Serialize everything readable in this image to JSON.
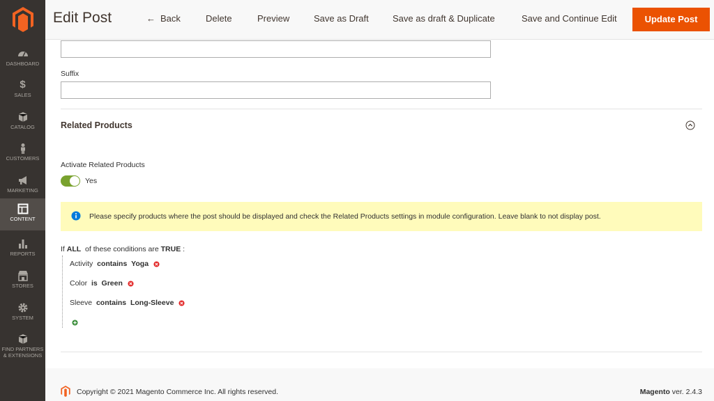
{
  "sidebar": {
    "items": [
      {
        "label": "DASHBOARD",
        "icon": "dashboard-icon"
      },
      {
        "label": "SALES",
        "icon": "dollar-icon"
      },
      {
        "label": "CATALOG",
        "icon": "cube-icon"
      },
      {
        "label": "CUSTOMERS",
        "icon": "person-icon"
      },
      {
        "label": "MARKETING",
        "icon": "megaphone-icon"
      },
      {
        "label": "CONTENT",
        "icon": "layout-icon"
      },
      {
        "label": "REPORTS",
        "icon": "bar-chart-icon"
      },
      {
        "label": "STORES",
        "icon": "storefront-icon"
      },
      {
        "label": "SYSTEM",
        "icon": "gear-icon"
      },
      {
        "label": "FIND PARTNERS",
        "label2": "& EXTENSIONS",
        "icon": "box-icon"
      }
    ]
  },
  "header": {
    "title": "Edit Post",
    "back": "Back",
    "delete": "Delete",
    "preview": "Preview",
    "save_draft": "Save as Draft",
    "save_duplicate": "Save as draft & Duplicate",
    "save_continue": "Save and Continue Edit",
    "update": "Update Post"
  },
  "form": {
    "suffix_label": "Suffix",
    "related_title": "Related Products",
    "activate_label": "Activate Related Products",
    "activate_value": "Yes",
    "notice": "Please specify products where the post should be displayed and check the Related Products settings in module configuration. Leave blank to not display post."
  },
  "conditions": {
    "if": "If",
    "aggregator": "ALL",
    "of_these": "of these conditions are",
    "value": "TRUE",
    "colon": ":",
    "rules": [
      {
        "attribute": "Activity",
        "operator": "contains",
        "value": "Yoga"
      },
      {
        "attribute": "Color",
        "operator": "is",
        "value": "Green"
      },
      {
        "attribute": "Sleeve",
        "operator": "contains",
        "value": "Long-Sleeve"
      }
    ]
  },
  "footer": {
    "copyright": "Copyright © 2021 Magento Commerce Inc. All rights reserved.",
    "brand": "Magento",
    "version": "ver. 2.4.3"
  },
  "colors": {
    "accent": "#eb5202",
    "sidebar": "#373330",
    "toggle_on": "#79a22e",
    "notice_bg": "#fffbbb"
  }
}
